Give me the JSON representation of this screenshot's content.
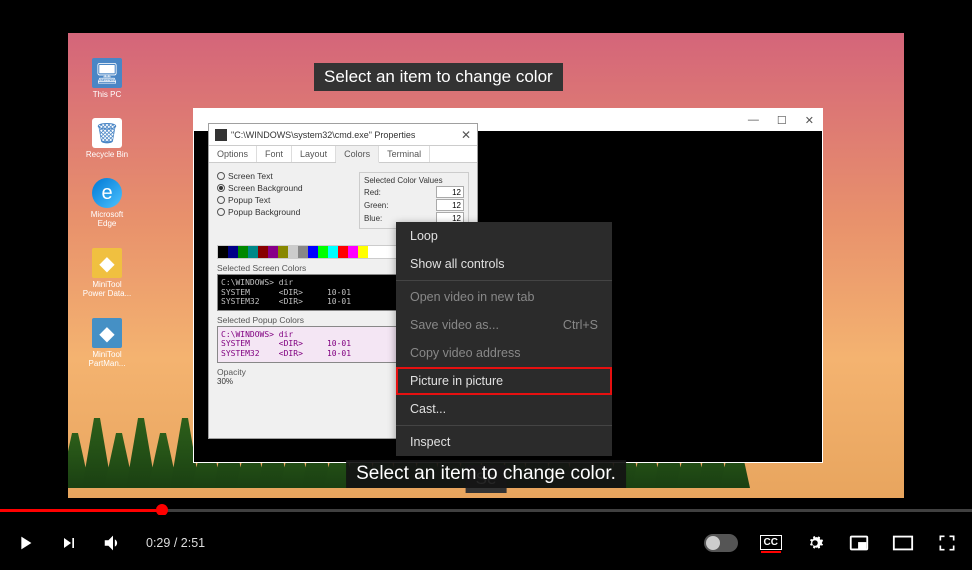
{
  "desktop_icons": {
    "thispc": "This PC",
    "recycle": "Recycle Bin",
    "edge": "Microsoft Edge",
    "minitool": "MiniTool Power Data...",
    "minitool2": "MiniTool PartMan..."
  },
  "banner_top": "Select an item to change color",
  "cmd_window": {
    "controls": {
      "min": "—",
      "max": "☐",
      "close": "✕"
    }
  },
  "props": {
    "title": "\"C:\\WINDOWS\\system32\\cmd.exe\" Properties",
    "close": "✕",
    "tabs": [
      "Options",
      "Font",
      "Layout",
      "Colors",
      "Terminal"
    ],
    "active_tab": "Colors",
    "radios": {
      "screen_text": "Screen Text",
      "screen_bg": "Screen Background",
      "popup_text": "Popup Text",
      "popup_bg": "Popup Background"
    },
    "scv_label": "Selected Color Values",
    "scv": {
      "red_label": "Red:",
      "red": "12",
      "green_label": "Green:",
      "green": "12",
      "blue_label": "Blue:",
      "blue": "12"
    },
    "section_screen": "Selected Screen Colors",
    "preview_screen": "C:\\WINDOWS> dir\nSYSTEM      <DIR>     10-01\nSYSTEM32    <DIR>     10-01",
    "section_popup": "Selected Popup Colors",
    "preview_popup": "C:\\WINDOWS> dir\nSYSTEM      <DIR>     10-01\nSYSTEM32    <DIR>     10-01",
    "opacity_label": "Opacity",
    "opacity_value": "30%"
  },
  "context_menu": {
    "loop": "Loop",
    "show_controls": "Show all controls",
    "open_tab": "Open video in new tab",
    "save_as": "Save video as...",
    "save_shortcut": "Ctrl+S",
    "copy_addr": "Copy video address",
    "pip": "Picture in picture",
    "cast": "Cast...",
    "inspect": "Inspect"
  },
  "subtitle_big": "Se",
  "caption": "Select an item to change color.",
  "player": {
    "current": "0:29",
    "sep": " / ",
    "duration": "2:51",
    "cc": "CC"
  }
}
